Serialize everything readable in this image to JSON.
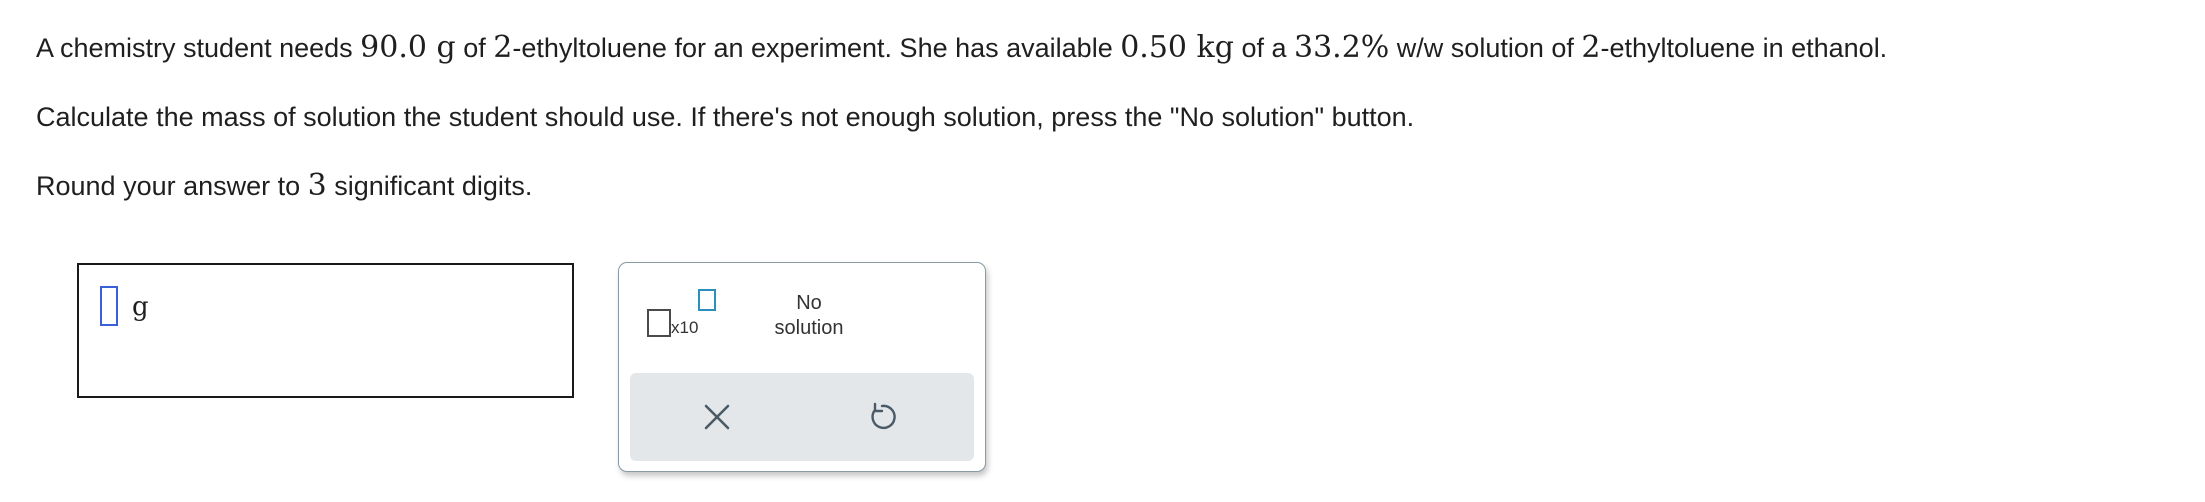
{
  "question": {
    "line1": {
      "t1": "A chemistry student needs ",
      "m1": "90.0 g",
      "t2": " of ",
      "m2": "2",
      "t3": "-ethyltoluene for an experiment. She has available ",
      "m3": "0.50 kg",
      "t4": " of a ",
      "m4": "33.2%",
      "t5": " w/w solution of ",
      "m5": "2",
      "t6": "-ethyltoluene in ethanol."
    },
    "line2": "Calculate the mass of solution the student should use. If there's not enough solution, press the \"No solution\" button.",
    "line3": {
      "t1": "Round your answer to ",
      "m1": "3",
      "t2": " significant digits."
    }
  },
  "answer": {
    "value": "",
    "unit": "g"
  },
  "tools": {
    "sci_label": "x10",
    "no_solution_line1": "No",
    "no_solution_line2": "solution",
    "clear_icon": "x-icon",
    "undo_icon": "undo-icon"
  },
  "colors": {
    "cursor_border": "#3b5fd9",
    "exponent_box": "#2a8fbf",
    "action_bar": "#e3e7ea",
    "panel_border": "#8a9aa4"
  }
}
